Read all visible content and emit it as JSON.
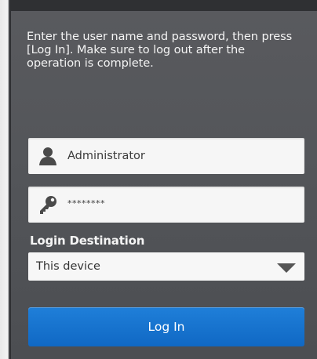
{
  "instructions": "Enter the user name and password, then press\n[Log In]. Make sure to log out after the\noperation is complete.",
  "username": {
    "value": "Administrator",
    "icon": "user-icon"
  },
  "password": {
    "value": "********",
    "icon": "key-icon"
  },
  "login_destination": {
    "label": "Login Destination",
    "selected": "This device",
    "icon": "chevron-down-icon"
  },
  "login_button": {
    "label": "Log In",
    "color": "#1068c4"
  }
}
